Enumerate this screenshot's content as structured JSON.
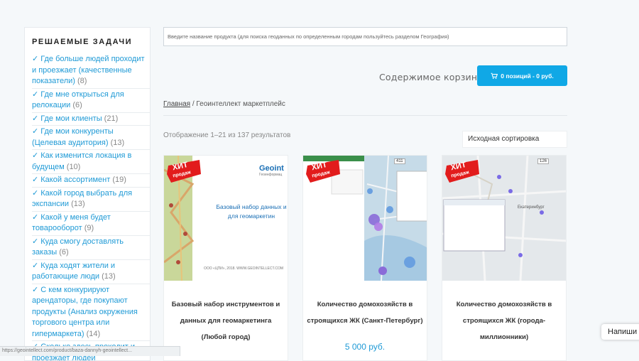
{
  "sidebar": {
    "heading": "РЕШАЕМЫЕ ЗАДАЧИ",
    "items": [
      {
        "label": "✓ Где больше людей проходит и проезжает (качественные показатели)",
        "count": "(8)"
      },
      {
        "label": "✓ Где мне открыться для релокации",
        "count": "(6)"
      },
      {
        "label": "✓ Где мои клиенты",
        "count": "(21)"
      },
      {
        "label": "✓ Где мои конкуренты (Целевая аудитория)",
        "count": "(13)"
      },
      {
        "label": "✓ Как изменится локация в будущем",
        "count": "(10)"
      },
      {
        "label": "✓ Какой ассортимент",
        "count": "(19)"
      },
      {
        "label": "✓ Какой город выбрать для экспансии",
        "count": "(13)"
      },
      {
        "label": "✓ Какой у меня будет товарооборот",
        "count": "(9)"
      },
      {
        "label": "✓ Куда смогу доставлять заказы",
        "count": "(6)"
      },
      {
        "label": "✓ Куда ходят жители и работающие люди",
        "count": "(13)"
      },
      {
        "label": "✓ С кем конкурируют арендаторы, где покупают продукты (Анализ окружения торгового центра или гипермаркета)",
        "count": "(14)"
      },
      {
        "label": "✓ Сколько здесь проходит и проезжает людей",
        "count": ""
      }
    ]
  },
  "search": {
    "placeholder": "Введите название продукта (для поиска геоданных по определенным городам пользуйтесь разделом География)"
  },
  "cart": {
    "label": "Содержимое корзины:",
    "button": "0 позиций - 0 руб."
  },
  "breadcrumb": {
    "home": "Главная",
    "separator": " / ",
    "current": "Геоинтеллект маркетплейс"
  },
  "results_text": "Отображение 1–21 из 137 результатов",
  "sort_selected": "Исходная сортировка",
  "badge": {
    "line1": "ХИТ",
    "line2": "продаж"
  },
  "products": [
    {
      "title": "Базовый набор инструментов и данных для геомаркетинга (Любой город)",
      "thumb": {
        "logo": "Geoint",
        "logo_sub": "Геоинформац",
        "text": "Базовый набор данных и для геомаркетин",
        "footer": "ООО «ЦПИ», 2018. WWW.GEOINTELLECT.COM"
      }
    },
    {
      "title": "Количество домохозяйств в строящихся ЖК (Санкт-Петербург)",
      "price": "5 000 руб.",
      "thumb": {
        "map_badge": "411"
      }
    },
    {
      "title": "Количество домохозяйств в строящихся ЖК (города-миллионники)",
      "thumb": {
        "map_badge": "126",
        "city": "Екатеринбург"
      }
    }
  ],
  "float_tab": "Напиши",
  "status_url": "https://geointellect.com/product/baza-dannyh-geointellect..."
}
